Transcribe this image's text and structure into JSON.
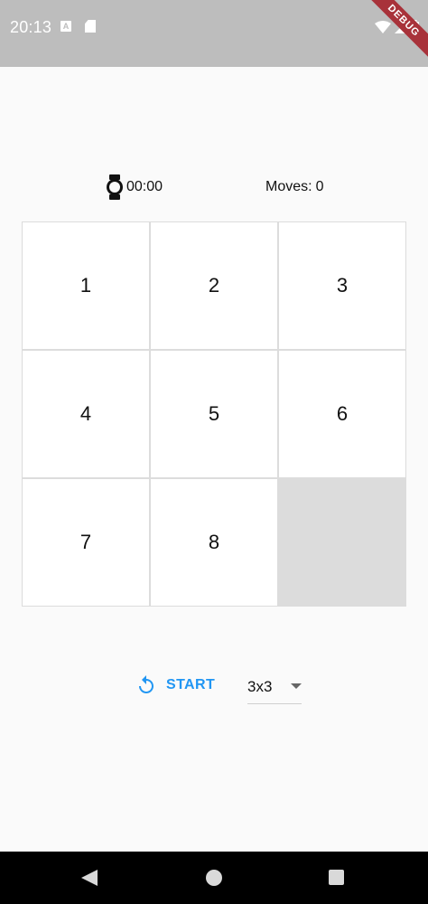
{
  "status_bar": {
    "time": "20:13",
    "badge_letter": "A",
    "debug_label": "DEBUG"
  },
  "game": {
    "timer": "00:00",
    "moves_label": "Moves:",
    "moves_value": "0",
    "tiles": [
      "1",
      "2",
      "3",
      "4",
      "5",
      "6",
      "7",
      "8",
      ""
    ]
  },
  "controls": {
    "start_label": "START",
    "size_selected": "3x3"
  },
  "colors": {
    "accent": "#2196f3",
    "status_bar": "#bdbdbd",
    "empty_tile": "#dcdcdc",
    "debug_banner": "#a8323a"
  },
  "icons": {
    "timer": "watch-icon",
    "start": "refresh-icon",
    "dropdown": "caret-down-icon",
    "nav": [
      "back-icon",
      "home-icon",
      "recents-icon"
    ]
  }
}
